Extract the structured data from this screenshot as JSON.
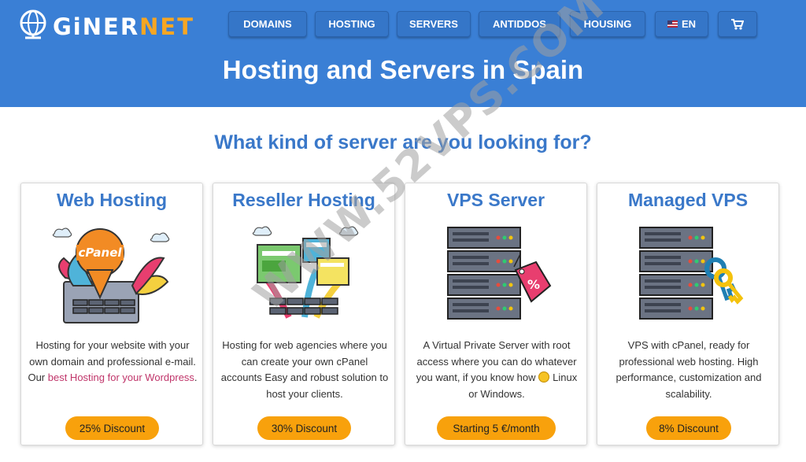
{
  "brand": {
    "name_part1": "GiNER",
    "name_part2": "NET"
  },
  "nav": {
    "items": [
      {
        "label": "DOMAINS"
      },
      {
        "label": "HOSTING"
      },
      {
        "label": "SERVERS"
      },
      {
        "label": "ANTIDDOS"
      },
      {
        "label": "HOUSING"
      }
    ],
    "language": "EN",
    "cart_icon": "cart-icon"
  },
  "hero": {
    "title": "Hosting and Servers in Spain"
  },
  "section": {
    "title": "What kind of server are you looking for?"
  },
  "cards": [
    {
      "title": "Web Hosting",
      "illustration": "cpanel-hosting-illustration",
      "desc_before": "Hosting for your website with your own domain and professional e-mail. Our ",
      "desc_link": "best Hosting for your Wordpress",
      "desc_after": ".",
      "badge": "25% Discount"
    },
    {
      "title": "Reseller Hosting",
      "illustration": "reseller-hosting-illustration",
      "desc": "Hosting for web agencies where you can create your own cPanel accounts Easy and robust solution to host your clients.",
      "badge": "30% Discount"
    },
    {
      "title": "VPS Server",
      "illustration": "server-rack-tag-illustration",
      "desc_before": "A Virtual Private Server with root access where you can do whatever you want, if you know how ",
      "desc_after": "Linux or Windows.",
      "badge": "Starting 5 €/month"
    },
    {
      "title": "Managed VPS",
      "illustration": "server-rack-keys-illustration",
      "desc": "VPS with cPanel, ready for professional web hosting. High performance, customization and scalability.",
      "badge": "8% Discount"
    }
  ],
  "watermark": "WWW.52VPS.COM",
  "colors": {
    "header": "#3a7fd5",
    "accent": "#3a78c9",
    "badge": "#f8a10c",
    "link": "#c0356a"
  }
}
